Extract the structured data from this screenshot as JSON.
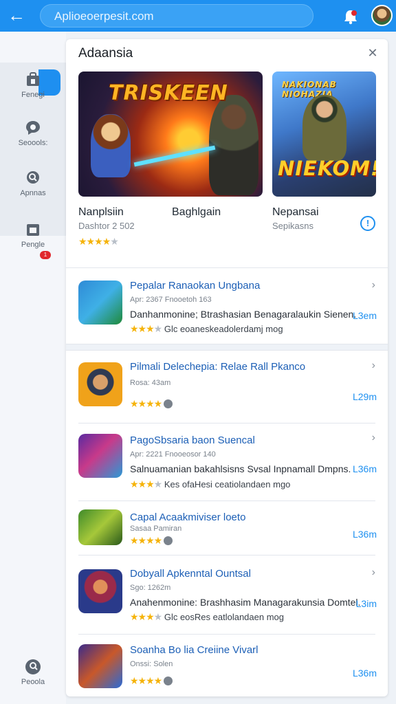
{
  "topbar": {
    "search_text": "Aplioeoerpesit.com"
  },
  "sidebar": {
    "items": [
      {
        "label": "Fenegi",
        "icon": "store-icon"
      },
      {
        "label": "Seoools:",
        "icon": "chat-icon"
      },
      {
        "label": "Apnnas",
        "icon": "search-icon"
      },
      {
        "label": "Pengle",
        "icon": "box-icon",
        "badge": "1"
      },
      {
        "label": "Peoola",
        "icon": "profile-icon"
      }
    ]
  },
  "panel": {
    "title": "Adaansia",
    "featured": [
      {
        "art_title": "TRISKEEN",
        "name": "Nanplsiin",
        "sub": "Dashtor 2 502",
        "rating_stars": 3.5
      },
      {
        "art_title_top": "NAKIONAB NIOHAZIA",
        "art_title_bottom": "NIEKOM!",
        "name": "Nepansai",
        "sub": "Sepikasns"
      }
    ],
    "middle_label": "Baghlgain",
    "apps": [
      {
        "title": "Pepalar Ranaokan Ungbana",
        "meta": "Apr: 2367 Fnooetoh 163",
        "desc": "Danhanmonine; Btrashasian Benagaralaukin Sienen.",
        "rating": "Glc eoaneskeadolerdamj mog",
        "size": "L3em",
        "stars": 3
      },
      {
        "title": "Pilmali Delechepia: Relae Rall Pkanco",
        "meta": "Rosa: 43am",
        "size": "L29m",
        "stars": 4
      },
      {
        "title": "PagoSbsaria baon Suencal",
        "meta": "Apr: 2221 Fnooeosor 140",
        "desc": "Salnuamanian bakahlsisns Svsal Inpnamall Dmpns.",
        "rating": "Kes ofaHesi ceatiolandaen mgo",
        "size": "L36m",
        "stars": 3
      },
      {
        "title": "Capal Acaakmiviser loeto",
        "meta": "Sasaa Pamiran",
        "size": "L36m",
        "stars": 4
      },
      {
        "title": "Dobyall Apkenntal Ountsal",
        "meta": "Sgo: 1262m",
        "desc": "Anahenmonine: Brashhasim Managarakunsia Domtel.",
        "rating": "Glc eosRes eatlolandaen mog",
        "size": "L3im",
        "stars": 3
      },
      {
        "title": "Soanha Bo lia Creiine Vivarl",
        "meta": "Onssi: Solen",
        "size": "L36m",
        "stars": 4
      }
    ]
  },
  "colors": {
    "accent": "#1e90f0",
    "star": "#f5b30a",
    "badge": "#e0282d"
  }
}
